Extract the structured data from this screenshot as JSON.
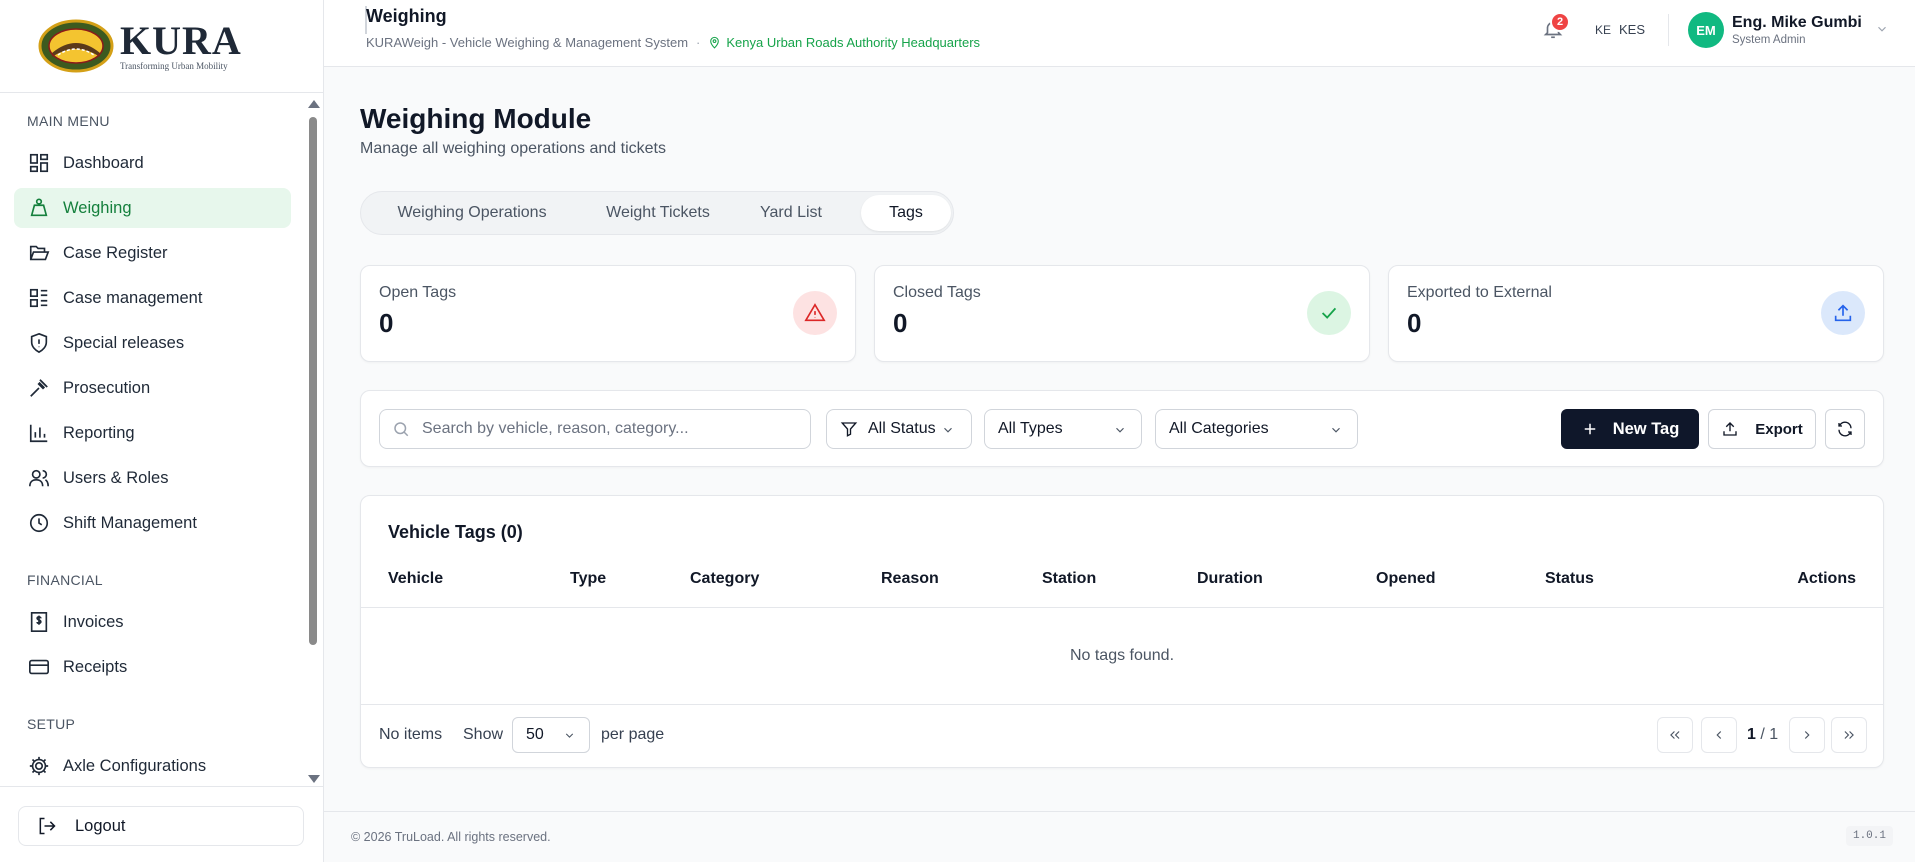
{
  "brand": {
    "name": "KURA",
    "tagline": "Transforming Urban Mobility"
  },
  "sidebar": {
    "sections": [
      {
        "label": "MAIN MENU"
      },
      {
        "label": "FINANCIAL"
      },
      {
        "label": "SETUP"
      }
    ],
    "items": [
      {
        "label": "Dashboard",
        "icon": "dashboard-icon"
      },
      {
        "label": "Weighing",
        "icon": "weighing-icon",
        "active": true
      },
      {
        "label": "Case Register",
        "icon": "folder-icon"
      },
      {
        "label": "Case management",
        "icon": "list-icon"
      },
      {
        "label": "Special releases",
        "icon": "shield-icon"
      },
      {
        "label": "Prosecution",
        "icon": "gavel-icon"
      },
      {
        "label": "Reporting",
        "icon": "bar-chart-icon"
      },
      {
        "label": "Users & Roles",
        "icon": "users-icon"
      },
      {
        "label": "Shift Management",
        "icon": "clock-icon"
      },
      {
        "label": "Invoices",
        "icon": "invoice-icon"
      },
      {
        "label": "Receipts",
        "icon": "card-icon"
      },
      {
        "label": "Axle Configurations",
        "icon": "gear-icon"
      }
    ],
    "logout_label": "Logout"
  },
  "header": {
    "title": "Weighing",
    "subtitle": "KURAWeigh - Vehicle Weighing & Management System",
    "separator": "·",
    "station": "Kenya Urban Roads Authority Headquarters",
    "notification_count": "2",
    "country_code": "KE",
    "currency": "KES",
    "user": {
      "initials": "EM",
      "name": "Eng. Mike Gumbi",
      "role": "System Admin"
    }
  },
  "page": {
    "title": "Weighing Module",
    "subtitle": "Manage all weighing operations and tickets",
    "tabs": [
      "Weighing Operations",
      "Weight Tickets",
      "Yard List",
      "Tags"
    ],
    "active_tab": "Tags"
  },
  "stats": [
    {
      "label": "Open Tags",
      "value": "0",
      "icon": "warning-icon",
      "color": "#dc2626",
      "bg": "#fde2e2"
    },
    {
      "label": "Closed Tags",
      "value": "0",
      "icon": "check-icon",
      "color": "#16a34a",
      "bg": "#dcf5e3"
    },
    {
      "label": "Exported to External",
      "value": "0",
      "icon": "upload-icon",
      "color": "#2563eb",
      "bg": "#dbe8fb"
    }
  ],
  "filters": {
    "search_placeholder": "Search by vehicle, reason, category...",
    "status": "All Status",
    "type": "All Types",
    "category": "All Categories",
    "new_tag": "New Tag",
    "export": "Export"
  },
  "table": {
    "title": "Vehicle Tags (0)",
    "columns": [
      "Vehicle",
      "Type",
      "Category",
      "Reason",
      "Station",
      "Duration",
      "Opened",
      "Status",
      "Actions"
    ],
    "empty_message": "No tags found.",
    "pagination": {
      "items_text": "No items",
      "show_label": "Show",
      "page_size": "50",
      "per_page_label": "per page",
      "current_page": "1",
      "total_pages": "/ 1"
    }
  },
  "footer": {
    "copyright": "© 2026 TruLoad. All rights reserved.",
    "version": "1.0.1"
  }
}
